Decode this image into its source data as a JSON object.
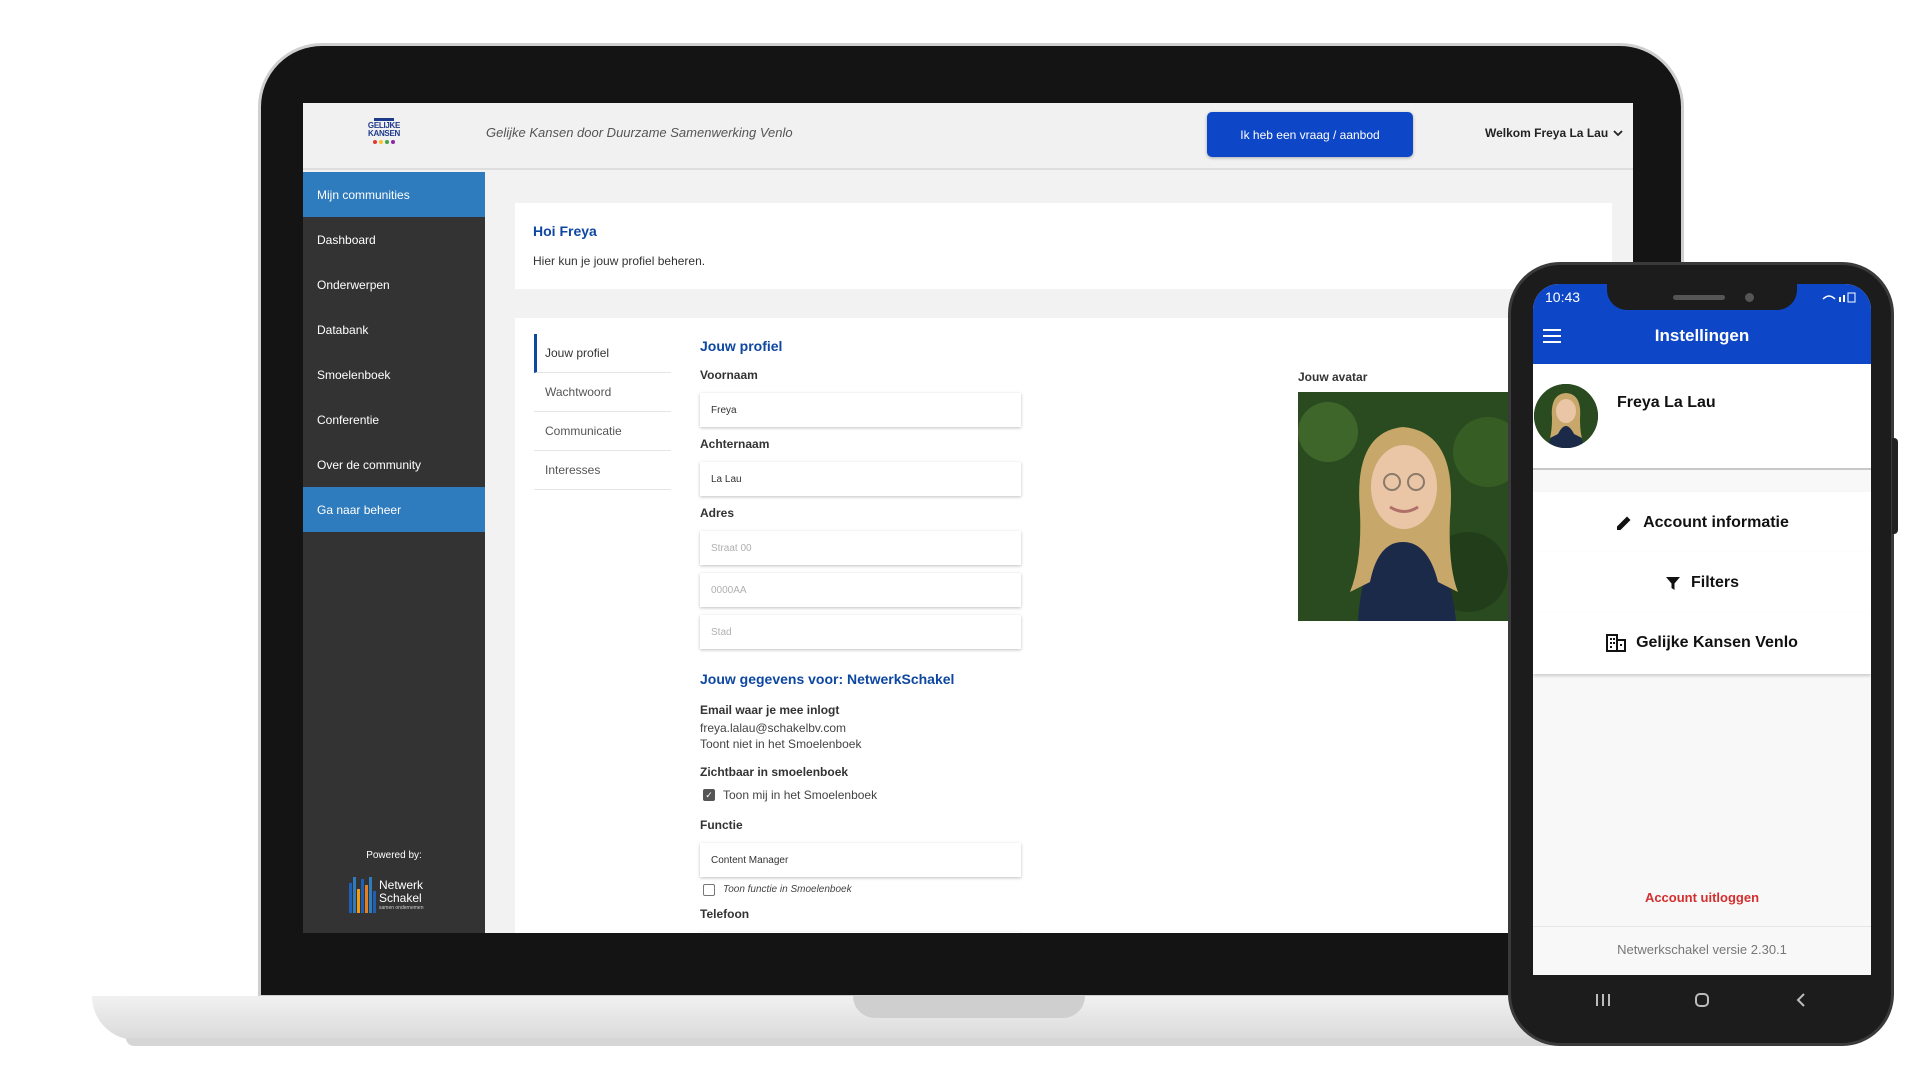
{
  "laptop": {
    "header": {
      "logo_text": "GELIJKE KANSEN",
      "tagline": "Gelijke Kansen door Duurzame Samenwerking Venlo",
      "cta_label": "Ik heb een vraag / aanbod",
      "welcome": "Welkom Freya La Lau"
    },
    "sidebar": {
      "items": [
        {
          "label": "Mijn communities",
          "active": true
        },
        {
          "label": "Dashboard"
        },
        {
          "label": "Onderwerpen"
        },
        {
          "label": "Databank"
        },
        {
          "label": "Smoelenboek"
        },
        {
          "label": "Conferentie"
        },
        {
          "label": "Over de community"
        },
        {
          "label": "Ga naar beheer",
          "active": true
        }
      ],
      "powered_by": "Powered by:",
      "brand_line1": "Netwerk",
      "brand_line2": "Schakel",
      "brand_sub": "samen ondernemen"
    },
    "greeting": {
      "title": "Hoi Freya",
      "subtitle": "Hier kun je jouw profiel beheren."
    },
    "tabs": [
      "Jouw profiel",
      "Wachtwoord",
      "Communicatie",
      "Interesses"
    ],
    "form": {
      "section_title": "Jouw profiel",
      "first_name_label": "Voornaam",
      "first_name_value": "Freya",
      "last_name_label": "Achternaam",
      "last_name_value": "La Lau",
      "address_label": "Adres",
      "street_placeholder": "Straat 00",
      "postcode_placeholder": "0000AA",
      "city_placeholder": "Stad",
      "section2_title": "Jouw gegevens voor: NetwerkSchakel",
      "email_label": "Email waar je mee inlogt",
      "email_value": "freya.lalau@schakelbv.com",
      "email_note": "Toont niet in het Smoelenboek",
      "visible_label": "Zichtbaar in smoelenboek",
      "visible_checkbox": "Toon mij in het Smoelenboek",
      "function_label": "Functie",
      "function_value": "Content Manager",
      "function_checkbox": "Toon functie in Smoelenboek",
      "phone_label": "Telefoon"
    },
    "avatar_label": "Jouw avatar"
  },
  "phone": {
    "time": "10:43",
    "title": "Instellingen",
    "user_name": "Freya La Lau",
    "menu": [
      {
        "label": "Account informatie",
        "icon": "pencil-icon"
      },
      {
        "label": "Filters",
        "icon": "filter-icon"
      },
      {
        "label": "Gelijke Kansen Venlo",
        "icon": "building-icon"
      }
    ],
    "logout": "Account uitloggen",
    "version": "Netwerkschakel versie 2.30.1"
  },
  "colors": {
    "primary": "#0d47c7",
    "heading": "#0d47a1",
    "sidebar": "#333333",
    "sidebar_active": "#2e7bbd",
    "logout": "#d32f2f"
  }
}
